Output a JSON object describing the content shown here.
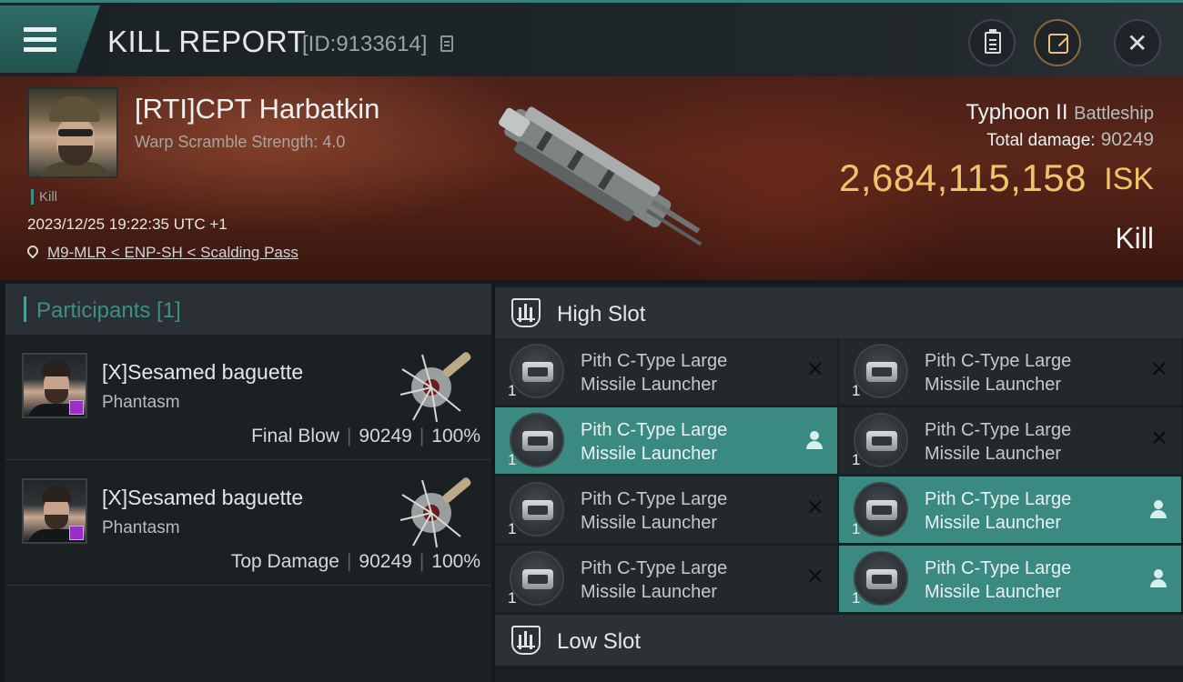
{
  "header": {
    "title": "KILL REPORT",
    "report_id": "[ID:9133614]"
  },
  "victim": {
    "pilot": "[RTI]CPT Harbatkin",
    "warp_scramble": "Warp Scramble Strength: 4.0",
    "tag": "Kill",
    "timestamp": "2023/12/25 19:22:35 UTC +1",
    "location": "M9-MLR < ENP-SH < Scalding Pass",
    "ship_name": "Typhoon II",
    "ship_class": "Battleship",
    "total_damage_label": "Total damage:",
    "total_damage": "90249",
    "isk_value": "2,684,115,158",
    "isk_unit": "ISK",
    "result": "Kill"
  },
  "participants": {
    "title": "Participants [1]",
    "rows": [
      {
        "name": "[X]Sesamed baguette",
        "ship": "Phantasm",
        "role": "Final Blow",
        "damage": "90249",
        "percent": "100%"
      },
      {
        "name": "[X]Sesamed baguette",
        "ship": "Phantasm",
        "role": "Top Damage",
        "damage": "90249",
        "percent": "100%"
      }
    ]
  },
  "slots": {
    "high_title": "High Slot",
    "low_title": "Low Slot",
    "modules": [
      {
        "line1": "Pith C-Type Large",
        "line2": "Missile Launcher",
        "qty": "1",
        "state": "destroyed"
      },
      {
        "line1": "Pith C-Type Large",
        "line2": "Missile Launcher",
        "qty": "1",
        "state": "destroyed"
      },
      {
        "line1": "Pith C-Type Large",
        "line2": "Missile Launcher",
        "qty": "1",
        "state": "dropped"
      },
      {
        "line1": "Pith C-Type Large",
        "line2": "Missile Launcher",
        "qty": "1",
        "state": "destroyed"
      },
      {
        "line1": "Pith C-Type Large",
        "line2": "Missile Launcher",
        "qty": "1",
        "state": "destroyed"
      },
      {
        "line1": "Pith C-Type Large",
        "line2": "Missile Launcher",
        "qty": "1",
        "state": "dropped"
      },
      {
        "line1": "Pith C-Type Large",
        "line2": "Missile Launcher",
        "qty": "1",
        "state": "destroyed"
      },
      {
        "line1": "Pith C-Type Large",
        "line2": "Missile Launcher",
        "qty": "1",
        "state": "dropped"
      }
    ],
    "destroyed_glyph": "✕"
  },
  "colors": {
    "accent": "#3a8a82",
    "isk": "#f0c36a",
    "background": "#15191c"
  },
  "icons": {
    "menu": "hamburger-icon",
    "copy": "copy-icon",
    "clipboard": "clipboard-icon",
    "share": "share-icon",
    "close": "close-icon",
    "location": "map-pin-icon",
    "slot": "slot-icon",
    "dropped": "person-icon",
    "destroyed": "x-icon"
  }
}
